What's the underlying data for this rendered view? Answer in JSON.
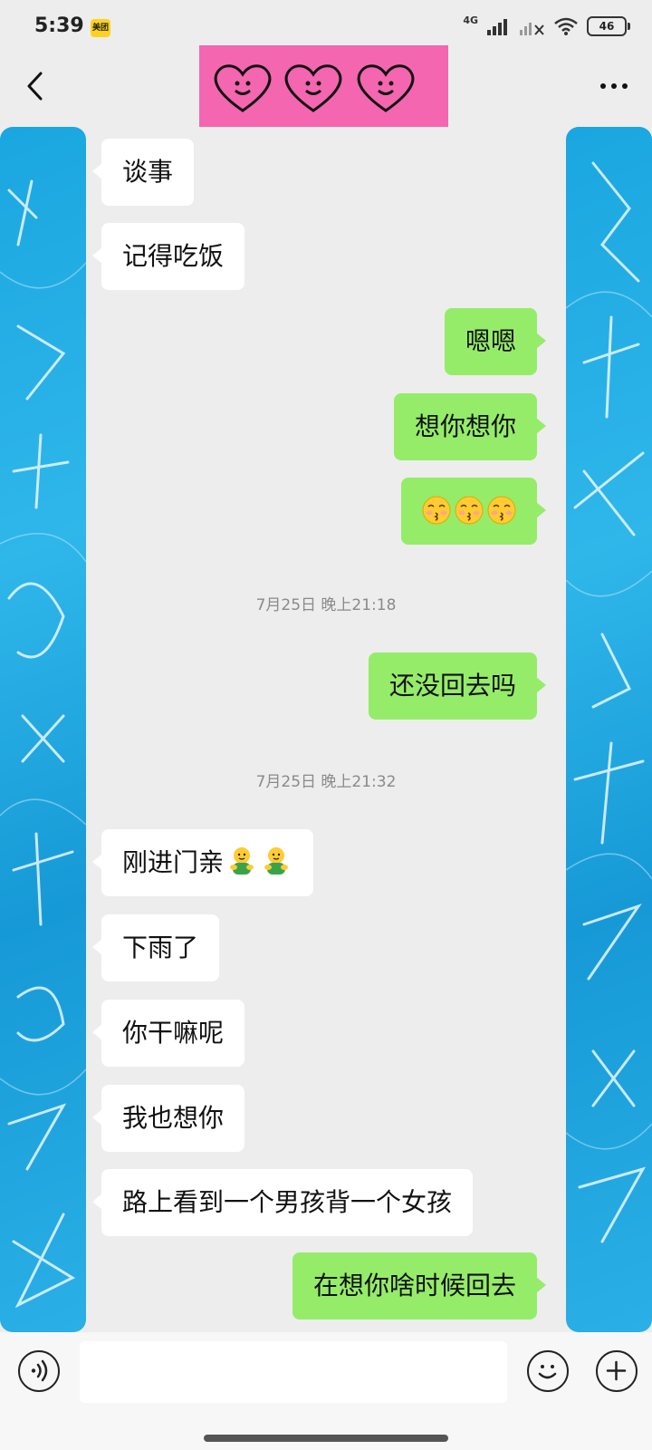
{
  "status_bar": {
    "time": "5:39",
    "app_badge": "美团",
    "network": "4G",
    "battery": "46"
  },
  "header": {
    "back_icon": "chevron-left-icon",
    "title_banner": "three-smiling-hearts",
    "more_icon": "more-dots-icon"
  },
  "messages": [
    {
      "side": "in",
      "text": "谈事"
    },
    {
      "side": "in",
      "text": "记得吃饭"
    },
    {
      "side": "out",
      "text": "嗯嗯"
    },
    {
      "side": "out",
      "text": "想你想你"
    },
    {
      "side": "out",
      "text": "",
      "emoji": "kissing-face",
      "emoji_count": 3
    },
    {
      "type": "timestamp",
      "text": "7月25日 晚上21:18"
    },
    {
      "side": "out",
      "text": "还没回去吗"
    },
    {
      "type": "timestamp",
      "text": "7月25日 晚上21:32"
    },
    {
      "side": "in",
      "text": "刚进门亲",
      "emoji": "hug-emoji",
      "emoji_count": 2
    },
    {
      "side": "in",
      "text": "下雨了"
    },
    {
      "side": "in",
      "text": "你干嘛呢"
    },
    {
      "side": "in",
      "text": "我也想你"
    },
    {
      "side": "in",
      "text": "路上看到一个男孩背一个女孩"
    },
    {
      "side": "out",
      "text": "在想你啥时候回去"
    }
  ],
  "input_bar": {
    "voice_icon": "voice-icon",
    "message_placeholder": "",
    "emoji_icon": "emoji-icon",
    "plus_icon": "plus-icon"
  },
  "colors": {
    "outgoing_bubble": "#95ec69",
    "incoming_bubble": "#ffffff",
    "chat_background": "#ededed",
    "banner": "#f466b0",
    "side_panel": "#1aa6e0"
  }
}
